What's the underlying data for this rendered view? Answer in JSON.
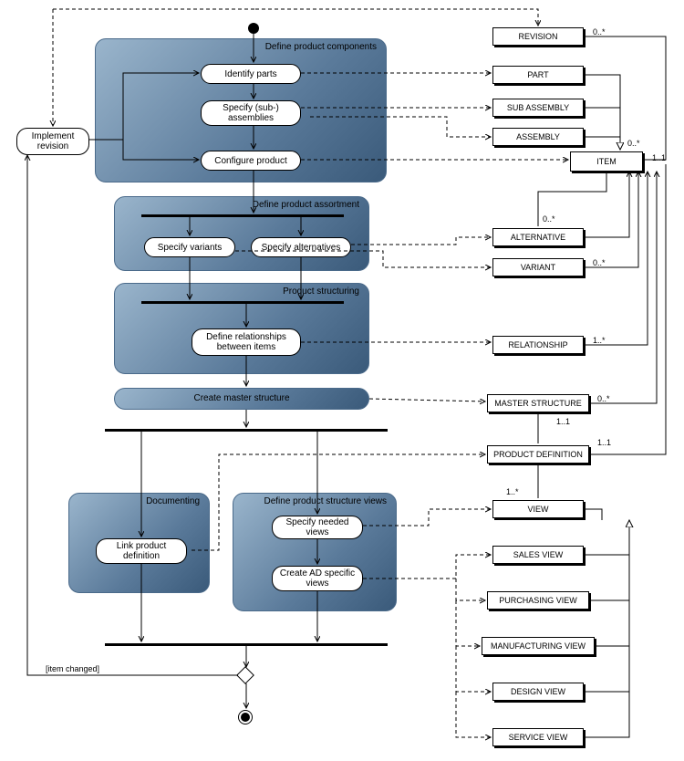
{
  "impl_revision": "Implement revision",
  "panels": {
    "components": {
      "title": "Define product components"
    },
    "assortment": {
      "title": "Define product assortment"
    },
    "structuring": {
      "title": "Product structuring"
    },
    "master": {
      "title": "Create master structure"
    },
    "documenting": {
      "title": "Documenting"
    },
    "views": {
      "title": "Define product structure views"
    }
  },
  "activities": {
    "identify_parts": "Identify parts",
    "specify_sub": "Specify (sub-) assemblies",
    "configure": "Configure product",
    "variants": "Specify variants",
    "alternatives": "Specify alternatives",
    "rel": "Define relationships between items",
    "link_pd": "Link product definition",
    "spec_views": "Specify needed views",
    "create_ad": "Create AD specific views"
  },
  "entities": {
    "revision": "REVISION",
    "part": "PART",
    "sub_assembly": "SUB ASSEMBLY",
    "assembly": "ASSEMBLY",
    "item": "ITEM",
    "alternative": "ALTERNATIVE",
    "variant": "VARIANT",
    "relationship": "RELATIONSHIP",
    "master_structure": "MASTER STRUCTURE",
    "product_def": "PRODUCT DEFINITION",
    "view": "VIEW",
    "sales_view": "SALES VIEW",
    "purchasing_view": "PURCHASING VIEW",
    "manufacturing_view": "MANUFACTURING VIEW",
    "design_view": "DESIGN VIEW",
    "service_view": "SERVICE VIEW"
  },
  "guard": "[item changed]",
  "mults": {
    "rev": "0..*",
    "item_a": "0..*",
    "item_b": "1..1",
    "alt": "0..*",
    "var": "0..*",
    "rel": "1..*",
    "ms": "0..*",
    "pd1": "1..1",
    "pd2": "1..1",
    "view": "1..*"
  }
}
